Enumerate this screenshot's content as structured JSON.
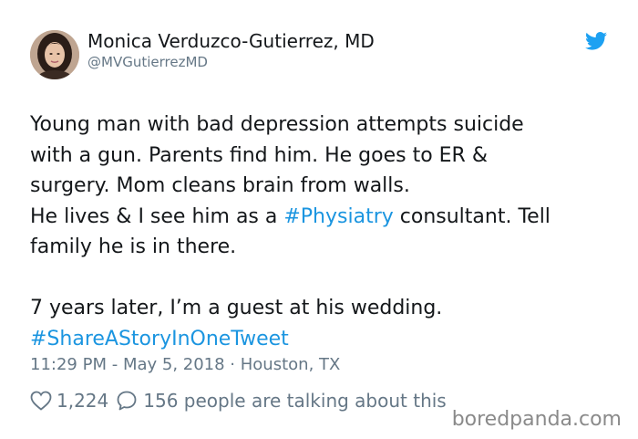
{
  "author": {
    "name": "Monica Verduzco-Gutierrez, MD",
    "handle": "@MVGutierrezMD",
    "avatar_icon": "profile-photo"
  },
  "brand": {
    "icon": "twitter-bird-icon",
    "color": "#1da1f2"
  },
  "tweet": {
    "line1": "Young man with bad depression attempts suicide",
    "line2": "with a gun. Parents find him. He goes to ER &",
    "line3": "surgery. Mom cleans brain from walls.",
    "line4_before": "He lives & I see him as a ",
    "line4_hashtag": "#Physiatry",
    "line4_after": " consultant. Tell",
    "line5": "family he is in there.",
    "line6": "7 years later, I’m a guest at his wedding.",
    "line7_hashtag": "#ShareAStoryInOneTweet",
    "hashtag_color": "#1b95e0"
  },
  "meta": {
    "time": "11:29 PM",
    "separator1": " - ",
    "date": "May 5, 2018",
    "separator2": " · ",
    "location": "Houston, TX"
  },
  "stats": {
    "like_icon": "heart-icon",
    "likes": "1,224",
    "reply_icon": "speech-bubble-icon",
    "talking": "156 people are talking about this"
  },
  "watermark": {
    "text": "boredpanda.com"
  }
}
